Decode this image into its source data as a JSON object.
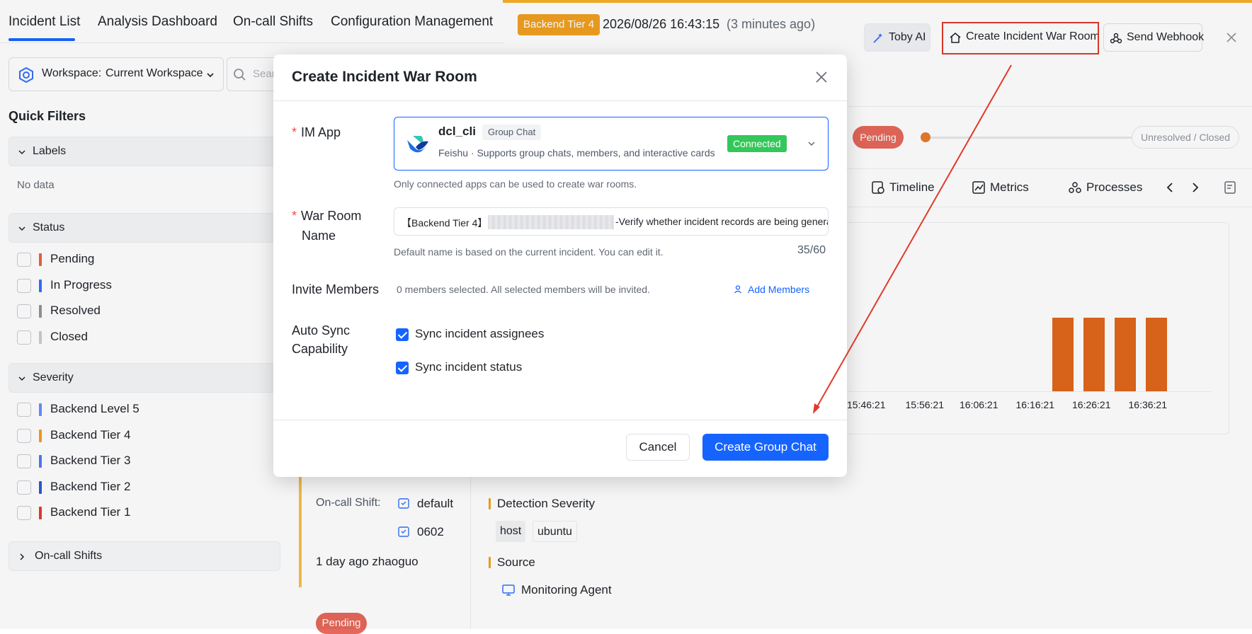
{
  "nav": {
    "tabs": [
      "Incident List",
      "Analysis Dashboard",
      "On-call Shifts",
      "Configuration Management"
    ]
  },
  "sidebar": {
    "workspace_label": "Workspace:",
    "workspace_value": "Current Workspace",
    "search_placeholder": "Sear",
    "quick_filters": "Quick Filters",
    "labels_title": "Labels",
    "labels_empty": "No data",
    "status_title": "Status",
    "status_items": [
      {
        "label": "Pending",
        "color": "#e8643c"
      },
      {
        "label": "In Progress",
        "color": "#3370ff"
      },
      {
        "label": "Resolved",
        "color": "#8f959e"
      },
      {
        "label": "Closed",
        "color": "#c9cdd4"
      }
    ],
    "severity_title": "Severity",
    "severity_items": [
      {
        "label": "Backend Level 5",
        "color": "#6b8cff"
      },
      {
        "label": "Backend Tier 4",
        "color": "#f0a020"
      },
      {
        "label": "Backend Tier 3",
        "color": "#4a7cf7"
      },
      {
        "label": "Backend Tier 2",
        "color": "#2a5ad9"
      },
      {
        "label": "Backend Tier 1",
        "color": "#e83a30"
      }
    ],
    "oncall_title": "On-call Shifts"
  },
  "detail": {
    "tier_badge": "Backend Tier 4",
    "datetime": "2026/08/26 16:43:15",
    "relative": "(3 minutes ago)",
    "toby_ai": "Toby AI",
    "create_war_room": "Create Incident War Room",
    "send_webhook": "Send Webhook",
    "status_start": "Pending",
    "status_end": "Unresolved / Closed",
    "tabs": [
      "Timeline",
      "Metrics",
      "Processes"
    ],
    "oncall_label": "On-call Shift:",
    "oncall_values": [
      "default",
      "0602"
    ],
    "activity": "1 day ago zhaoguo",
    "detection_severity": "Detection Severity",
    "tags": [
      "host",
      "ubuntu"
    ],
    "source_title": "Source",
    "source_value": "Monitoring Agent",
    "pending_pill": "Pending",
    "accent": "#1664ff"
  },
  "chart_data": {
    "type": "bar",
    "categories": [
      "15:46:21",
      "15:56:21",
      "16:06:21",
      "16:16:21",
      "16:26:21",
      "16:36:21"
    ],
    "bars": [
      {
        "x": "16:26:21",
        "offset": -0.7,
        "value": 1
      },
      {
        "x": "16:26:21",
        "offset": 0.0,
        "value": 1
      },
      {
        "x": "16:26:21",
        "offset": 0.7,
        "value": 1
      },
      {
        "x": "16:36:21",
        "offset": -0.2,
        "value": 1
      }
    ],
    "color": "#e0661c"
  },
  "modal": {
    "title": "Create Incident War Room",
    "im_app_label": "IM App",
    "app_name": "dcl_cli",
    "app_tag": "Group Chat",
    "app_desc": "Feishu · Supports group chats, members, and interactive cards",
    "app_status": "Connected",
    "im_hint": "Only connected apps can be used to create war rooms.",
    "room_name_label_1": "War Room",
    "room_name_label_2": "Name",
    "room_name_prefix": "【Backend Tier 4】",
    "room_name_suffix": "-Verify whether incident records are being generated",
    "room_name_hint": "Default name is based on the current incident. You can edit it.",
    "room_name_count": "35/60",
    "invite_label": "Invite Members",
    "invite_hint": "0 members selected. All selected members will be invited.",
    "add_members": "Add Members",
    "sync_label_1": "Auto Sync",
    "sync_label_2": "Capability",
    "sync_assignees": "Sync incident assignees",
    "sync_status": "Sync incident status",
    "cancel": "Cancel",
    "create": "Create Group Chat"
  }
}
